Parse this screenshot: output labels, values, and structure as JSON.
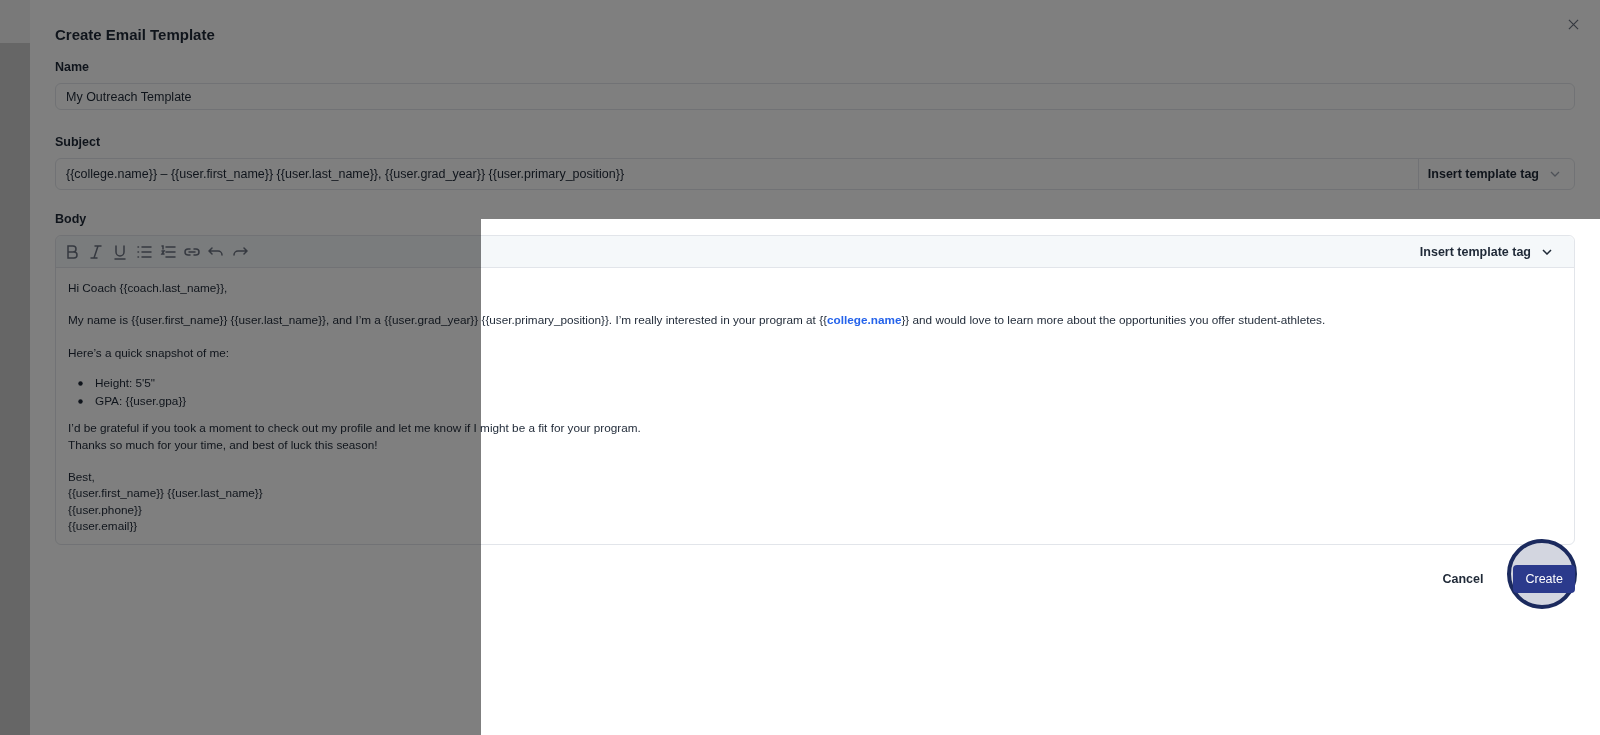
{
  "dialog": {
    "title": "Create Email Template"
  },
  "name_field": {
    "label": "Name",
    "value": "My Outreach Template"
  },
  "subject_field": {
    "label": "Subject",
    "value": "{{college.name}} – {{user.first_name}} {{user.last_name}}, {{user.grad_year}} {{user.primary_position}}",
    "insert_button": "Insert template tag"
  },
  "body": {
    "label": "Body",
    "toolbar": [
      {
        "kind": "bold"
      },
      {
        "kind": "italic"
      },
      {
        "kind": "underline"
      },
      {
        "kind": "bullets"
      },
      {
        "kind": "numbers"
      },
      {
        "kind": "link"
      },
      {
        "kind": "undo"
      },
      {
        "kind": "redo"
      }
    ],
    "insert_button": "Insert template tag",
    "content": [
      {
        "kind": "paragraph",
        "lines": [
          "Hi Coach {{coach.last_name}},"
        ]
      },
      {
        "kind": "rich",
        "parts": [
          {
            "kind": "plain",
            "text": "My name is {{user.first_name}} {{user.last_name}}, and I’m a {{user.grad_year}} {{user.primary_position}}. I’m really interested in your program at {{"
          },
          {
            "kind": "tag",
            "text": "college.name"
          },
          {
            "kind": "plain",
            "text": "}} and would love to learn more about the opportunities you offer student-athletes."
          }
        ]
      },
      {
        "kind": "paragraph",
        "lines": [
          "Here’s a quick snapshot of me:"
        ]
      },
      {
        "kind": "list",
        "items": [
          "Height: 5'5\"",
          "GPA: {{user.gpa}}"
        ]
      },
      {
        "kind": "paragraph",
        "lines": [
          "I’d be grateful if you took a moment to check out my profile and let me know if I might be a fit for your program.",
          "Thanks so much for your time, and best of luck this season!"
        ]
      },
      {
        "kind": "paragraph",
        "lines": [
          "Best,",
          "{{user.first_name}} {{user.last_name}}",
          "{{user.phone}}",
          "{{user.email}}"
        ]
      }
    ]
  },
  "actions": {
    "cancel": "Cancel",
    "create": "Create"
  }
}
